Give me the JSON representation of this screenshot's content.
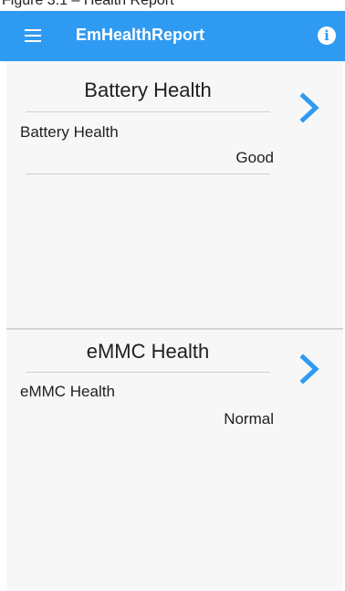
{
  "status_bar": {
    "text": "Figure 3.1 – Health Report"
  },
  "app_bar": {
    "menu_icon": "hamburger-menu-icon",
    "title": "EmHealthReport",
    "info_icon": "info-icon",
    "info_glyph": "i",
    "accent_color": "#2f9af1"
  },
  "cards": [
    {
      "title": "Battery Health",
      "item_label": "Battery Health",
      "item_value": "Good",
      "chevron_icon": "chevron-right-icon"
    },
    {
      "title": "eMMC Health",
      "item_label": "eMMC Health",
      "item_value": "Normal",
      "chevron_icon": "chevron-right-icon"
    }
  ]
}
